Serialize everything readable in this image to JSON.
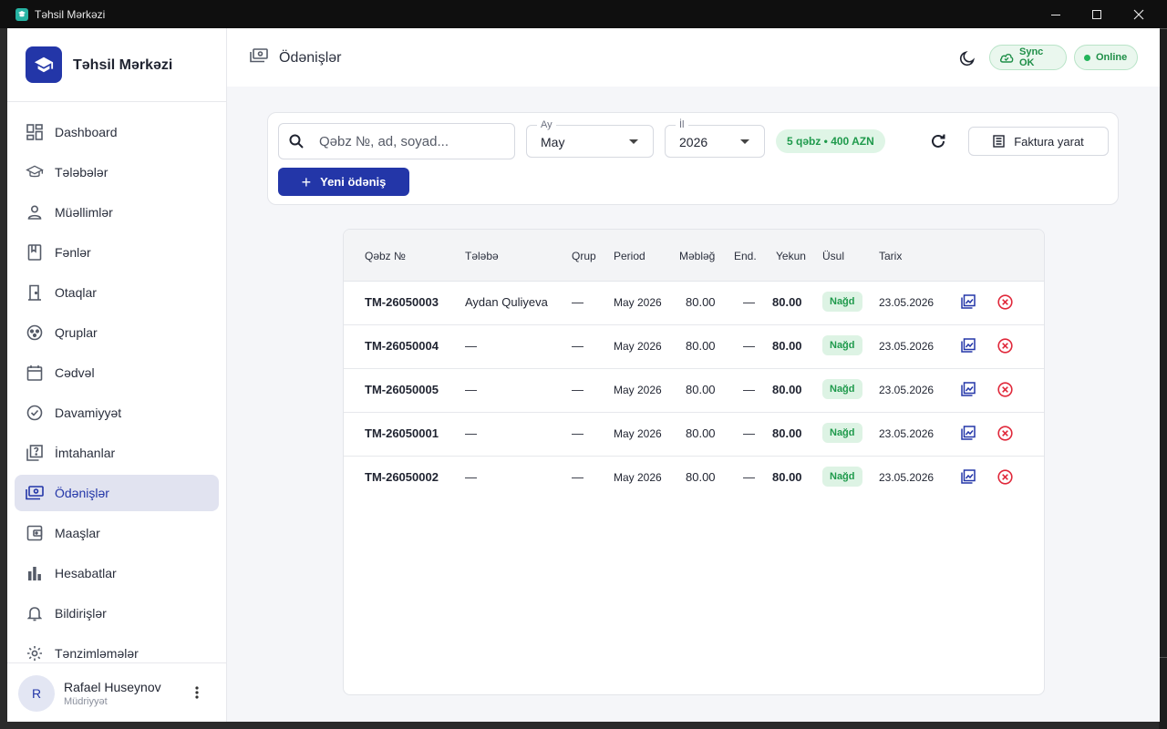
{
  "window": {
    "title": "Təhsil Mərkəzi"
  },
  "brand": {
    "name": "Təhsil Mərkəzi"
  },
  "sidebar": {
    "items": [
      {
        "label": "Dashboard",
        "icon": "dashboard-icon"
      },
      {
        "label": "Tələbələr",
        "icon": "graduation-cap-icon"
      },
      {
        "label": "Müəllimlər",
        "icon": "person-icon"
      },
      {
        "label": "Fənlər",
        "icon": "book-icon"
      },
      {
        "label": "Otaqlar",
        "icon": "door-icon"
      },
      {
        "label": "Qruplar",
        "icon": "group-icon"
      },
      {
        "label": "Cədvəl",
        "icon": "calendar-icon"
      },
      {
        "label": "Davamiyyət",
        "icon": "check-circle-icon"
      },
      {
        "label": "İmtahanlar",
        "icon": "quiz-icon"
      },
      {
        "label": "Ödənişlər",
        "icon": "payments-icon",
        "active": true
      },
      {
        "label": "Maaşlar",
        "icon": "wallet-icon"
      },
      {
        "label": "Hesabatlar",
        "icon": "bar-chart-icon"
      },
      {
        "label": "Bildirişlər",
        "icon": "bell-icon"
      },
      {
        "label": "Tənzimləmələr",
        "icon": "gear-icon"
      }
    ]
  },
  "user": {
    "initial": "R",
    "name": "Rafael Huseynov",
    "role": "Müdriyyət"
  },
  "header": {
    "title": "Ödənişlər",
    "sync_label": "Sync OK",
    "online_label": "Online"
  },
  "filters": {
    "search_placeholder": "Qəbz №, ad, soyad...",
    "month_label": "Ay",
    "month_value": "May",
    "year_label": "İl",
    "year_value": "2026",
    "summary": "5 qəbz • 400 AZN",
    "invoice_button": "Faktura yarat",
    "new_button": "Yeni ödəniş"
  },
  "table": {
    "columns": [
      "Qəbz №",
      "Tələbə",
      "Qrup",
      "Period",
      "Məbləğ",
      "End.",
      "Yekun",
      "Üsul",
      "Tarix"
    ],
    "rows": [
      {
        "id": "TM-26050003",
        "student": "Aydan Quliyeva",
        "group": "—",
        "period": "May 2026",
        "amount": "80.00",
        "discount": "—",
        "total": "80.00",
        "method": "Nağd",
        "date": "23.05.2026"
      },
      {
        "id": "TM-26050004",
        "student": "—",
        "group": "—",
        "period": "May 2026",
        "amount": "80.00",
        "discount": "—",
        "total": "80.00",
        "method": "Nağd",
        "date": "23.05.2026"
      },
      {
        "id": "TM-26050005",
        "student": "—",
        "group": "—",
        "period": "May 2026",
        "amount": "80.00",
        "discount": "—",
        "total": "80.00",
        "method": "Nağd",
        "date": "23.05.2026"
      },
      {
        "id": "TM-26050001",
        "student": "—",
        "group": "—",
        "period": "May 2026",
        "amount": "80.00",
        "discount": "—",
        "total": "80.00",
        "method": "Nağd",
        "date": "23.05.2026"
      },
      {
        "id": "TM-26050002",
        "student": "—",
        "group": "—",
        "period": "May 2026",
        "amount": "80.00",
        "discount": "—",
        "total": "80.00",
        "method": "Nağd",
        "date": "23.05.2026"
      }
    ]
  },
  "colors": {
    "primary": "#2336a8",
    "success": "#1f9a4c",
    "danger": "#e0283a",
    "active_nav_bg": "#e1e3f0"
  }
}
